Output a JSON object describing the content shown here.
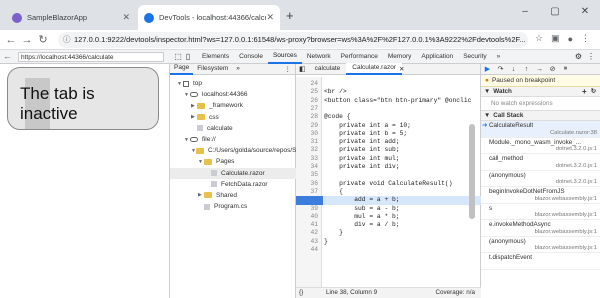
{
  "browser": {
    "tabs": [
      {
        "title": "SampleBlazorApp",
        "active": false
      },
      {
        "title": "DevTools - localhost:44366/calculate",
        "active": true
      }
    ],
    "address": "127.0.0.1:9222/devtools/inspector.html?ws=127.0.0.1:61548/ws-proxy?browser=ws%3A%2F%2F127.0.0.1%3A9222%2Fdevtools%2F..."
  },
  "viewport": {
    "url": "https://localhost:44366/calculate",
    "box_text": "The tab is inactive"
  },
  "devtools": {
    "tabs": [
      "Elements",
      "Console",
      "Sources",
      "Network",
      "Performance",
      "Memory",
      "Application",
      "Security"
    ],
    "active_tab": "Sources",
    "more": "»",
    "nav": {
      "tabs": [
        "Page",
        "Filesystem"
      ],
      "more": "»",
      "tree": [
        {
          "label": "top",
          "type": "root",
          "indent": 1
        },
        {
          "label": "localhost:44366",
          "type": "cloud",
          "indent": 2
        },
        {
          "label": "_framework",
          "type": "folder",
          "indent": 3
        },
        {
          "label": "css",
          "type": "folder",
          "indent": 3
        },
        {
          "label": "calculate",
          "type": "file",
          "indent": 3
        },
        {
          "label": "file://",
          "type": "cloud",
          "indent": 2
        },
        {
          "label": "C:/Users/golda/source/repos/S",
          "type": "folder",
          "indent": 3
        },
        {
          "label": "Pages",
          "type": "folder",
          "indent": 4
        },
        {
          "label": "Calculate.razor",
          "type": "file",
          "indent": 5,
          "selected": true
        },
        {
          "label": "FetchData.razor",
          "type": "file",
          "indent": 5
        },
        {
          "label": "Shared",
          "type": "folder",
          "indent": 4
        },
        {
          "label": "Program.cs",
          "type": "file",
          "indent": 4
        }
      ]
    },
    "editor": {
      "tabs": [
        "calculate",
        "Calculate.razor"
      ],
      "active_tab": "Calculate.razor",
      "lines": [
        {
          "n": "24",
          "code": ""
        },
        {
          "n": "25",
          "code": "<br />"
        },
        {
          "n": "26",
          "code": "<button class=\"btn btn-primary\" @onclic"
        },
        {
          "n": "27",
          "code": ""
        },
        {
          "n": "28",
          "code": "@code {"
        },
        {
          "n": "29",
          "code": "    private int a = 10;"
        },
        {
          "n": "30",
          "code": "    private int b = 5;"
        },
        {
          "n": "31",
          "code": "    private int add;"
        },
        {
          "n": "32",
          "code": "    private int sub;"
        },
        {
          "n": "33",
          "code": "    private int mul;"
        },
        {
          "n": "34",
          "code": "    private int div;"
        },
        {
          "n": "35",
          "code": ""
        },
        {
          "n": "36",
          "code": "    private void CalculateResult()"
        },
        {
          "n": "37",
          "code": "    {"
        },
        {
          "n": "38",
          "code": "        add = a + b;"
        },
        {
          "n": "39",
          "code": "        sub = a - b;"
        },
        {
          "n": "40",
          "code": "        mul = a * b;"
        },
        {
          "n": "41",
          "code": "        div = a / b;"
        },
        {
          "n": "42",
          "code": "    }"
        },
        {
          "n": "43",
          "code": "}"
        },
        {
          "n": "44",
          "code": ""
        }
      ],
      "status": "Line 38, Column 9",
      "coverage": "Coverage: n/a"
    },
    "debugger": {
      "paused": "Paused on breakpoint",
      "watch_label": "Watch",
      "watch_empty": "No watch expressions",
      "callstack_label": "Call Stack",
      "frames": [
        {
          "fn": "CalculateResult",
          "loc": "Calculate.razor:38",
          "current": true
        },
        {
          "fn": "Module._mono_wasm_invoke_...",
          "loc": "dotnet.3.2.0.js:1"
        },
        {
          "fn": "call_method",
          "loc": "dotnet.3.2.0.js:1"
        },
        {
          "fn": "(anonymous)",
          "loc": "dotnet.3.2.0.js:1"
        },
        {
          "fn": "beginInvokeDotNetFromJS",
          "loc": "blazor.webassembly.js:1"
        },
        {
          "fn": "s",
          "loc": "blazor.webassembly.js:1"
        },
        {
          "fn": "e.invokeMethodAsync",
          "loc": "blazor.webassembly.js:1"
        },
        {
          "fn": "(anonymous)",
          "loc": "blazor.webassembly.js:1"
        },
        {
          "fn": "t.dispatchEvent",
          "loc": ""
        }
      ]
    }
  }
}
